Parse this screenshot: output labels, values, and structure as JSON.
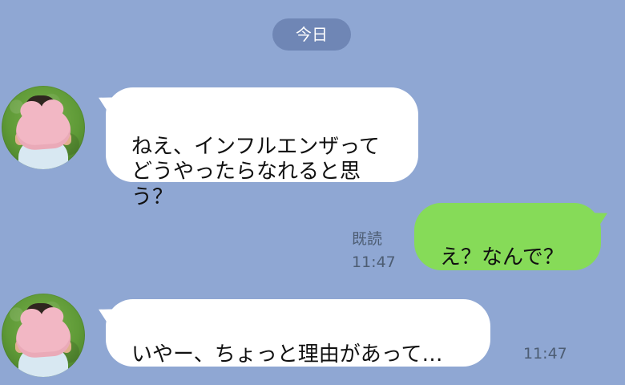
{
  "date_divider": "今日",
  "messages": [
    {
      "side": "left",
      "text": "ねえ、インフルエンザって\nどうやったらなれると思う？"
    },
    {
      "side": "right",
      "read_label": "既読",
      "time": "11:47",
      "text": "え？なんで？"
    },
    {
      "side": "left",
      "text": "いやー、ちょっと理由があって…",
      "time": "11:47"
    }
  ]
}
